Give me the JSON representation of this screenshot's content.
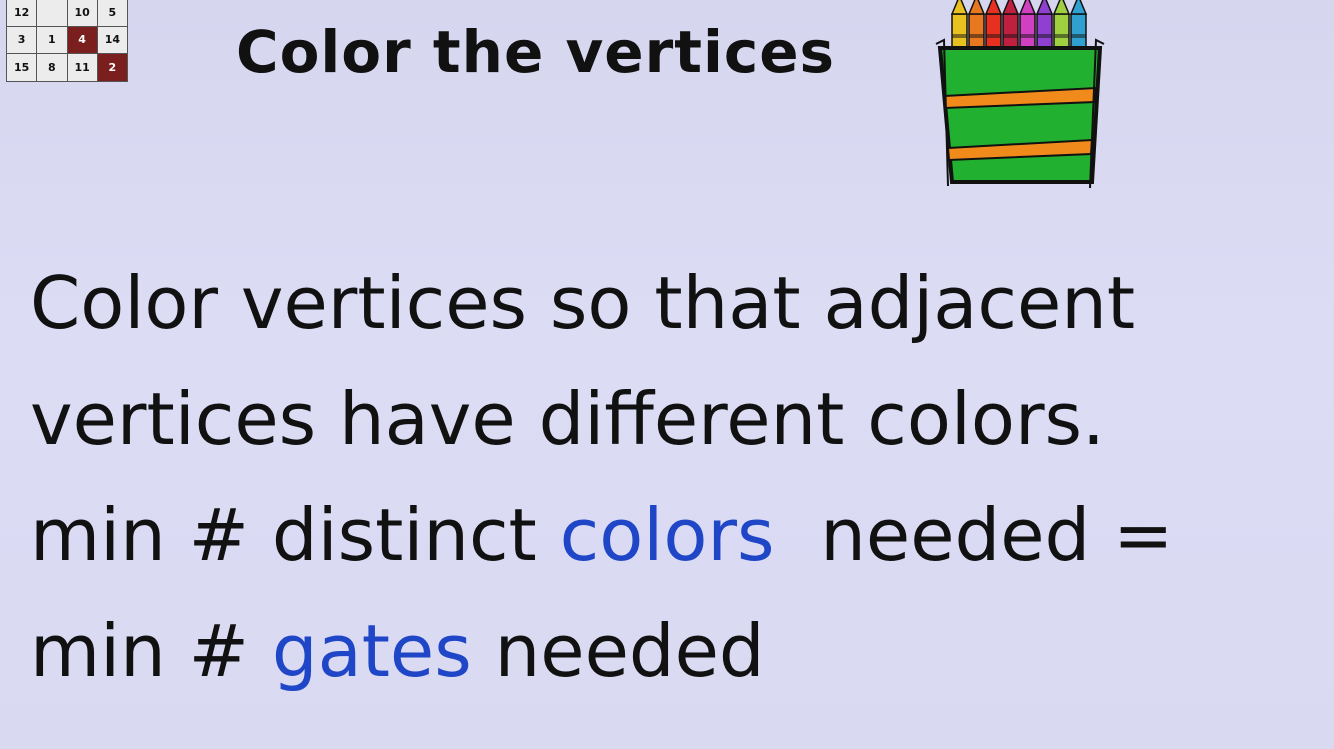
{
  "grid": {
    "rows": [
      [
        {
          "v": "12",
          "dark": false
        },
        {
          "v": "",
          "dark": false
        },
        {
          "v": "10",
          "dark": false
        },
        {
          "v": "5",
          "dark": false
        }
      ],
      [
        {
          "v": "3",
          "dark": false
        },
        {
          "v": "1",
          "dark": false
        },
        {
          "v": "4",
          "dark": true
        },
        {
          "v": "14",
          "dark": false
        }
      ],
      [
        {
          "v": "15",
          "dark": false
        },
        {
          "v": "8",
          "dark": false
        },
        {
          "v": "11",
          "dark": false
        },
        {
          "v": "2",
          "dark": true
        }
      ]
    ],
    "dark_color": "#7a1e1e"
  },
  "title": "Color the vertices",
  "illustration": {
    "icon": "crayon-box-icon",
    "crayon_colors": [
      "#e8c020",
      "#e87820",
      "#e83020",
      "#c02040",
      "#d040c0",
      "#9040d0",
      "#a0d040",
      "#30a0d0"
    ],
    "box_color": "#22b030",
    "stripe_color": "#f08a1a"
  },
  "lines": {
    "l1": "Color vertices so that adjacent",
    "l2": "vertices have different colors.",
    "l3_a": "min # distinct ",
    "l3_hl": "colors",
    "l3_b": "  needed =",
    "l4_a": "min # ",
    "l4_hl": "gates",
    "l4_b": " needed"
  },
  "highlight_color": "#1e46c6"
}
